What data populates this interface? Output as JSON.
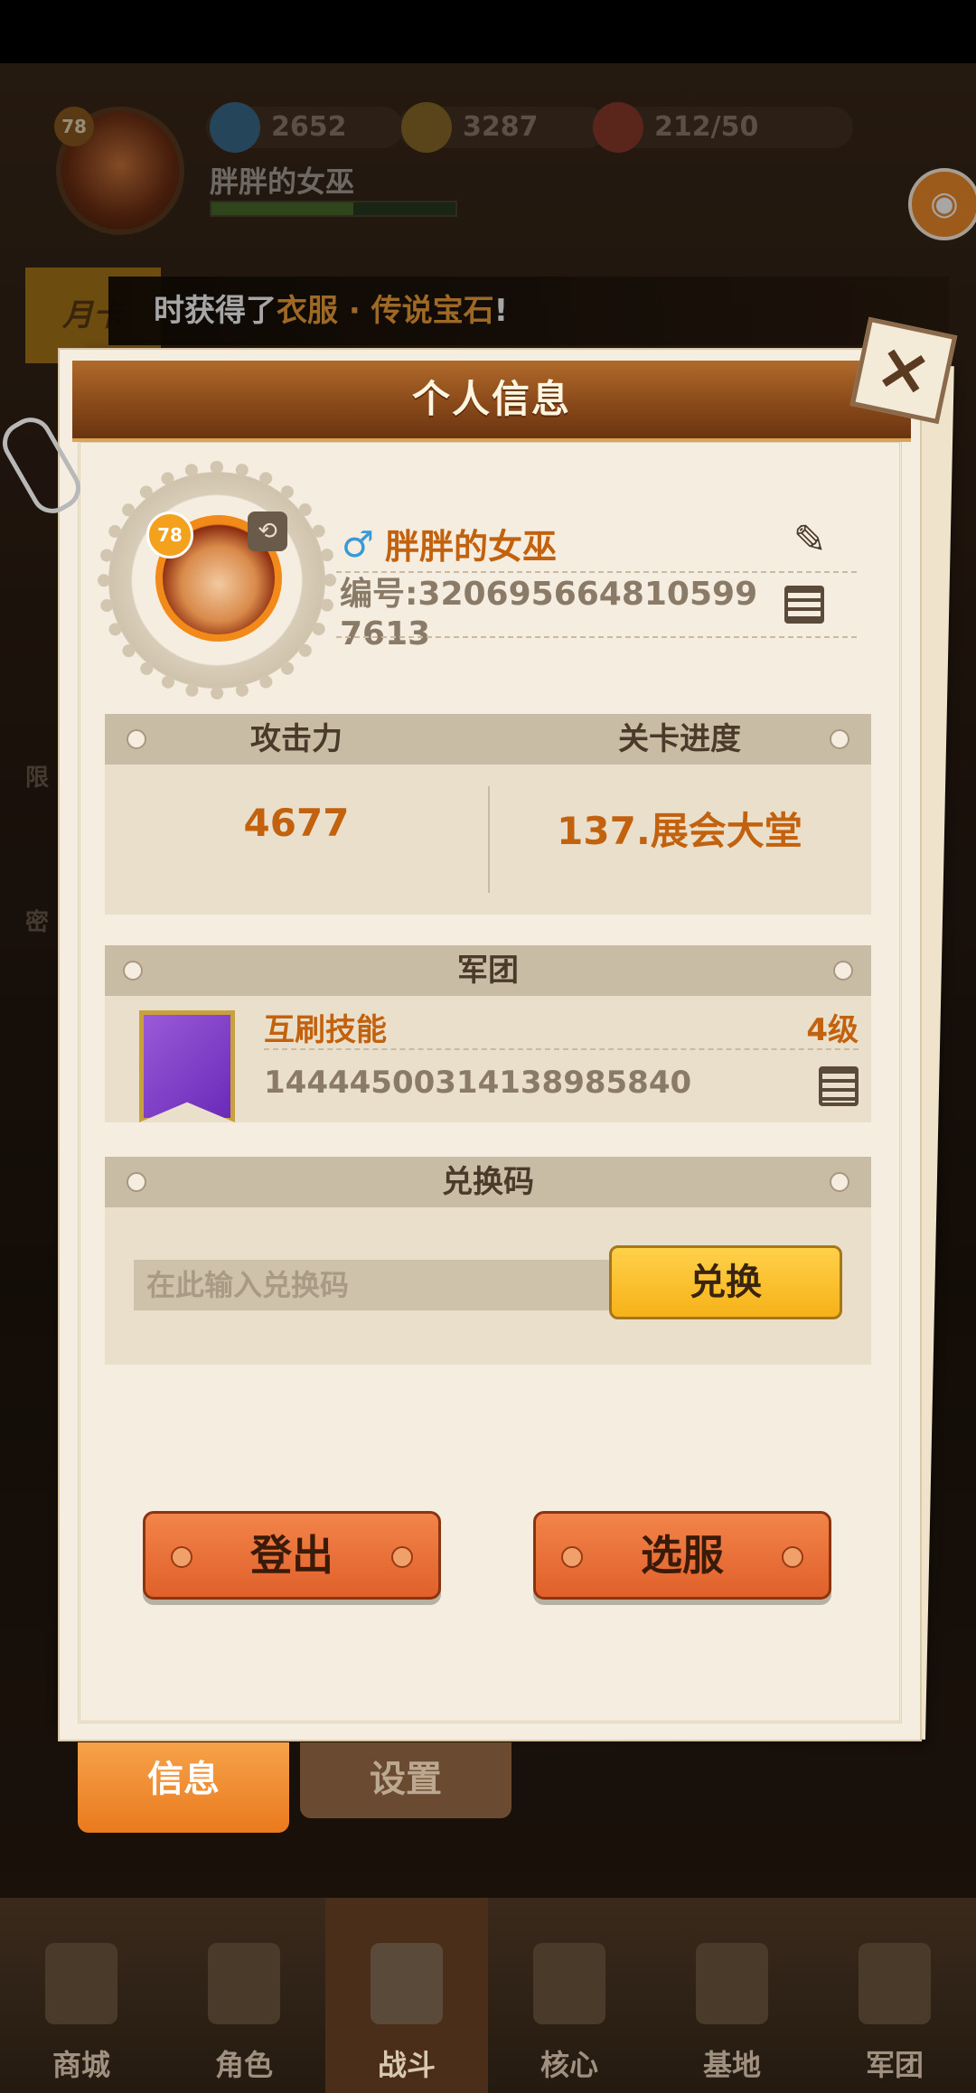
{
  "hud": {
    "level": "78",
    "gems": "2652",
    "coins": "3287",
    "stamina": "212/50",
    "player_name": "胖胖的女巫",
    "month_card": "月卡",
    "ticker_prefix": "时获得了",
    "ticker_item": "衣服 · 传说宝石",
    "ticker_suffix": "!"
  },
  "side_labels": {
    "left_1": "限",
    "left_2": "密"
  },
  "panel": {
    "title": "个人信息",
    "close_icon": "×",
    "profile": {
      "level": "78",
      "gender_icon": "♂",
      "name": "胖胖的女巫",
      "id": "编号:3206956648105997613"
    },
    "stats": {
      "attack_label": "攻击力",
      "progress_label": "关卡进度",
      "attack_value": "4677",
      "progress_value": "137.展会大堂"
    },
    "guild": {
      "header": "军团",
      "name": "互刷技能",
      "level": "4级",
      "id": "1444450031413898584​0"
    },
    "redeem": {
      "header": "兑换码",
      "placeholder": "在此输入兑换码",
      "button": "兑换"
    },
    "logout_button": "登出",
    "server_button": "选服"
  },
  "tabs": {
    "info": "信息",
    "settings": "设置"
  },
  "nav": [
    "商城",
    "角色",
    "战斗",
    "核心",
    "基地",
    "军团"
  ],
  "colors": {
    "accent": "#c2620e",
    "panel": "#f5ede0",
    "button": "#e0602a",
    "tab_active": "#f28a2a"
  }
}
